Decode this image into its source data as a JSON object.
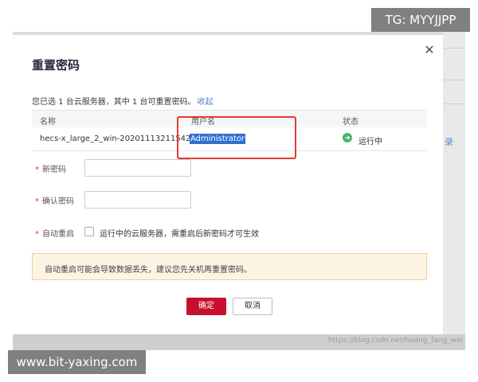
{
  "modal": {
    "title": "重置密码",
    "close_icon": "close-icon",
    "summary": "您已选 1 台云服务器，其中 1 台可重置密码。",
    "collapse_link": "收起",
    "table": {
      "headers": [
        "名称",
        "用户名",
        "状态"
      ],
      "rows": [
        {
          "name": "hecs-x_large_2_win-20201113211542",
          "username": "Administrator",
          "status": "运行中",
          "status_icon": "arrow-right-circle-icon"
        }
      ]
    },
    "fields": {
      "new_password_label": "新密码",
      "confirm_password_label": "确认密码",
      "auto_restart_label": "自动重启",
      "required_mark": "*",
      "auto_restart_text": "运行中的云服务器，需重启后新密码才可生效"
    },
    "warning": "自动重启可能会导致数据丢失，建议您先关机再重置密码。",
    "buttons": {
      "ok": "确定",
      "cancel": "取消"
    }
  },
  "background": {
    "right_text": "录"
  },
  "overlays": {
    "tg_badge": "TG: MYYJJPP",
    "site_badge": "www.bit-yaxing.com",
    "csdn_watermark": "https://blog.csdn.net/huang_fang_wei"
  },
  "colors": {
    "primary_button": "#c8102e",
    "highlight": "#2f6fd1",
    "status_running": "#44b36e",
    "annotation_box": "#e53935",
    "warning_bg": "#fdf4e4"
  }
}
